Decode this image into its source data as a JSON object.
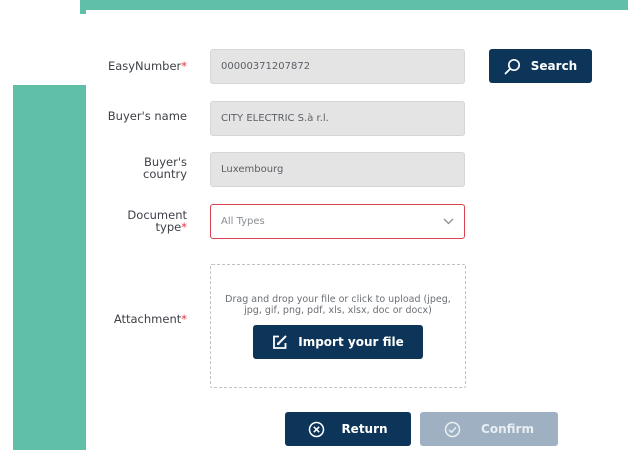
{
  "form": {
    "easynumber": {
      "label": "EasyNumber",
      "required_mark": "*",
      "value": "00000371207872"
    },
    "buyer_name": {
      "label": "Buyer's name",
      "value": "CITY ELECTRIC  S.à r.l."
    },
    "buyer_country": {
      "label_line1": "Buyer's",
      "label_line2": "country",
      "value": "Luxembourg"
    },
    "document_type": {
      "label_line1": "Document",
      "label_line2": "type",
      "required_mark": "*",
      "selected": "All Types"
    },
    "attachment": {
      "label": "Attachment",
      "required_mark": "*",
      "dropzone_text_line1": "Drag and drop your file or click to upload (jpeg,",
      "dropzone_text_line2": "jpg, gif, png, pdf, xls, xlsx, doc or docx)",
      "import_label": "Import your file"
    }
  },
  "buttons": {
    "search_label": "Search",
    "return_label": "Return",
    "confirm_label": "Confirm"
  },
  "icons": {
    "search": "search-icon",
    "chevron": "chevron-down-icon",
    "upload": "edit-upload-icon",
    "return": "close-circle-icon",
    "confirm": "check-circle-icon"
  },
  "colors": {
    "accent": "#5fbfa7",
    "primary": "#0d3559",
    "required": "#e0313f",
    "disabled_button": "#9eb0c2"
  }
}
